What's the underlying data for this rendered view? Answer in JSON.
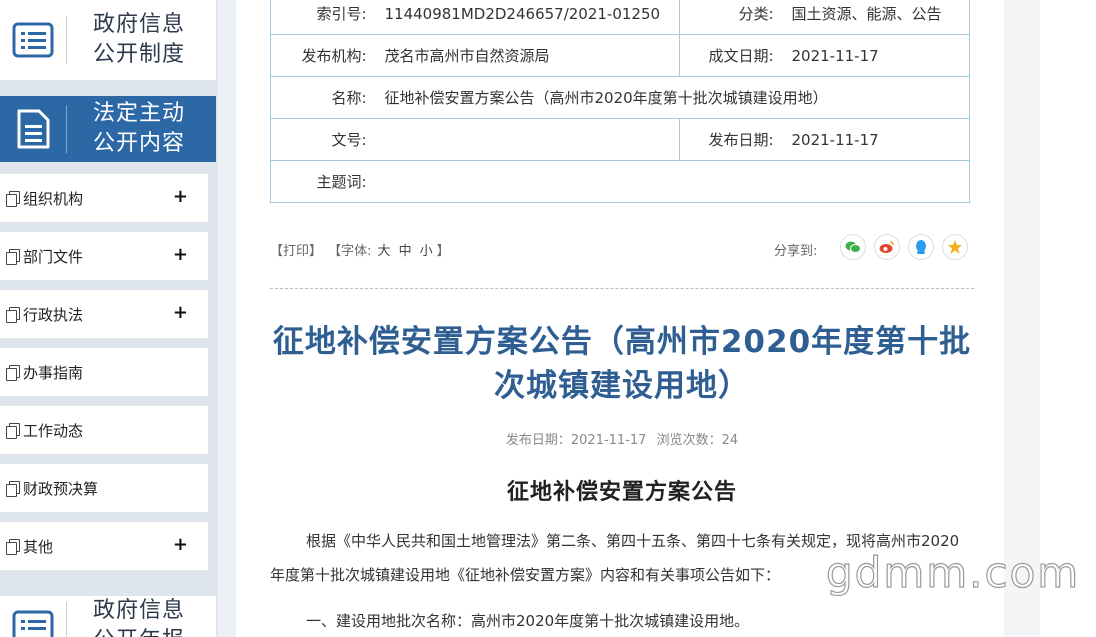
{
  "sidebar": {
    "top_block": {
      "title": "政府信息公开制度",
      "icon": "list-doc-icon"
    },
    "active_block": {
      "title": "法定主动公开内容",
      "icon": "doc-lines-icon"
    },
    "bottom_block": {
      "title": "政府信息公开年报",
      "icon": "list-doc-icon"
    },
    "items": [
      {
        "label": "组织机构",
        "expand": "+"
      },
      {
        "label": "部门文件",
        "expand": "+"
      },
      {
        "label": "行政执法",
        "expand": "+"
      },
      {
        "label": "办事指南",
        "expand": ""
      },
      {
        "label": "工作动态",
        "expand": ""
      },
      {
        "label": "财政预决算",
        "expand": ""
      },
      {
        "label": "其他",
        "expand": "+"
      }
    ]
  },
  "meta": {
    "index_no": {
      "label": "索引号:",
      "value": "11440981MD2D246657/2021-01250"
    },
    "category": {
      "label": "分类:",
      "value": "国土资源、能源、公告"
    },
    "publisher": {
      "label": "发布机构:",
      "value": "茂名市高州市自然资源局"
    },
    "created": {
      "label": "成文日期:",
      "value": "2021-11-17"
    },
    "name": {
      "label": "名称:",
      "value": "征地补偿安置方案公告（高州市2020年度第十批次城镇建设用地）"
    },
    "doc_no": {
      "label": "文号:",
      "value": ""
    },
    "published": {
      "label": "发布日期:",
      "value": "2021-11-17"
    },
    "keywords": {
      "label": "主题词:",
      "value": ""
    }
  },
  "toolbar": {
    "print": "【打印】",
    "font_open": "【字体:",
    "font_large": "大",
    "font_medium": "中",
    "font_small": "小",
    "font_close": "】",
    "share_label": "分享到:",
    "share": [
      {
        "name": "wechat-share-icon",
        "color": "#3fb04a"
      },
      {
        "name": "weibo-share-icon",
        "color": "#e0452c"
      },
      {
        "name": "qq-share-icon",
        "color": "#2b9cf0"
      },
      {
        "name": "qzone-share-icon",
        "color": "#f2b01a"
      }
    ]
  },
  "article": {
    "title": "征地补偿安置方案公告（高州市2020年度第十批次城镇建设用地）",
    "date_label": "发布日期：",
    "date": "2021-11-17",
    "views_label": "浏览次数：",
    "views": "24",
    "subtitle": "征地补偿安置方案公告",
    "para1": "根据《中华人民共和国土地管理法》第二条、第四十五条、第四十七条有关规定，现将高州市2020年度第十批次城镇建设用地《征地补偿安置方案》内容和有关事项公告如下：",
    "para2": "一、建设用地批次名称：高州市2020年度第十批次城镇建设用地。"
  },
  "watermark": "gdmm.com"
}
